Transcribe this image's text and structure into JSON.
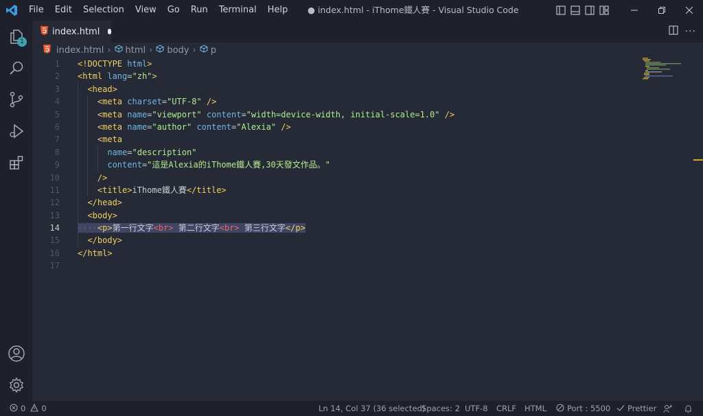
{
  "titlebar": {
    "menu": [
      "File",
      "Edit",
      "Selection",
      "View",
      "Go",
      "Run",
      "Terminal",
      "Help"
    ],
    "window_title": "● index.html - iThome鐵人賽 - Visual Studio Code"
  },
  "activity": {
    "explorer_badge": "1"
  },
  "tab": {
    "name": "index.html"
  },
  "breadcrumb": [
    "index.html",
    "html",
    "body",
    "p"
  ],
  "editor": {
    "active_line": 14,
    "lines": [
      {
        "n": "1",
        "indent": 0,
        "parts": [
          [
            "t",
            "<!DOCTYPE"
          ],
          [
            "p",
            " "
          ],
          [
            "a",
            "html"
          ],
          [
            "t",
            ">"
          ]
        ]
      },
      {
        "n": "2",
        "indent": 0,
        "parts": [
          [
            "t",
            "<html"
          ],
          [
            "p",
            " "
          ],
          [
            "a",
            "lang"
          ],
          [
            "p",
            "="
          ],
          [
            "s",
            "\"zh\""
          ],
          [
            "t",
            ">"
          ]
        ]
      },
      {
        "n": "3",
        "indent": 1,
        "parts": [
          [
            "t",
            "<head>"
          ]
        ]
      },
      {
        "n": "4",
        "indent": 2,
        "parts": [
          [
            "t",
            "<meta"
          ],
          [
            "p",
            " "
          ],
          [
            "a",
            "charset"
          ],
          [
            "p",
            "="
          ],
          [
            "s",
            "\"UTF-8\""
          ],
          [
            "p",
            " "
          ],
          [
            "t",
            "/>"
          ]
        ]
      },
      {
        "n": "5",
        "indent": 2,
        "parts": [
          [
            "t",
            "<meta"
          ],
          [
            "p",
            " "
          ],
          [
            "a",
            "name"
          ],
          [
            "p",
            "="
          ],
          [
            "s",
            "\"viewport\""
          ],
          [
            "p",
            " "
          ],
          [
            "a",
            "content"
          ],
          [
            "p",
            "="
          ],
          [
            "s",
            "\"width=device-width, initial-scale=1.0\""
          ],
          [
            "p",
            " "
          ],
          [
            "t",
            "/>"
          ]
        ]
      },
      {
        "n": "6",
        "indent": 2,
        "parts": [
          [
            "t",
            "<meta"
          ],
          [
            "p",
            " "
          ],
          [
            "a",
            "name"
          ],
          [
            "p",
            "="
          ],
          [
            "s",
            "\"author\""
          ],
          [
            "p",
            " "
          ],
          [
            "a",
            "content"
          ],
          [
            "p",
            "="
          ],
          [
            "s",
            "\"Alexia\""
          ],
          [
            "p",
            " "
          ],
          [
            "t",
            "/>"
          ]
        ]
      },
      {
        "n": "7",
        "indent": 2,
        "parts": [
          [
            "t",
            "<meta"
          ]
        ]
      },
      {
        "n": "8",
        "indent": 3,
        "parts": [
          [
            "a",
            "name"
          ],
          [
            "p",
            "="
          ],
          [
            "s",
            "\"description\""
          ]
        ]
      },
      {
        "n": "9",
        "indent": 3,
        "parts": [
          [
            "a",
            "content"
          ],
          [
            "p",
            "="
          ],
          [
            "s",
            "\"這是Alexia的iThome鐵人賽,30天發文作品。\""
          ]
        ]
      },
      {
        "n": "10",
        "indent": 2,
        "parts": [
          [
            "t",
            "/>"
          ]
        ]
      },
      {
        "n": "11",
        "indent": 2,
        "parts": [
          [
            "t",
            "<title>"
          ],
          [
            "p",
            "iThome鐵人賽"
          ],
          [
            "t",
            "</title>"
          ]
        ]
      },
      {
        "n": "12",
        "indent": 1,
        "parts": [
          [
            "t",
            "</head>"
          ]
        ]
      },
      {
        "n": "13",
        "indent": 1,
        "parts": [
          [
            "t",
            "<body>"
          ]
        ]
      },
      {
        "n": "14",
        "indent": 2,
        "ws": "····",
        "parts": [
          [
            "t",
            "<p>"
          ],
          [
            "p",
            "第一行文字"
          ],
          [
            "tr",
            "<br>"
          ],
          [
            "p",
            " 第二行文字"
          ],
          [
            "tr",
            "<br>"
          ],
          [
            "p",
            " 第三行文字"
          ],
          [
            "t",
            "</p>"
          ]
        ]
      },
      {
        "n": "15",
        "indent": 1,
        "parts": [
          [
            "t",
            "</body>"
          ]
        ]
      },
      {
        "n": "16",
        "indent": 0,
        "parts": [
          [
            "t",
            "</html>"
          ]
        ]
      },
      {
        "n": "17",
        "indent": 0,
        "parts": []
      }
    ]
  },
  "statusbar": {
    "errors": "0",
    "warnings": "0",
    "cursor": "Ln 14, Col 37 (36 selected)",
    "spaces": "Spaces: 2",
    "encoding": "UTF-8",
    "eol": "CRLF",
    "language": "HTML",
    "port": "Port : 5500",
    "prettier": "Prettier"
  },
  "colors": {
    "background": "#262a37",
    "bars": "#1e212c",
    "tag": "#f2cf5f",
    "attribute": "#6fb6e3",
    "string": "#b5ea8c",
    "br_tag": "#e5686c",
    "badge": "#3ea6b1"
  }
}
